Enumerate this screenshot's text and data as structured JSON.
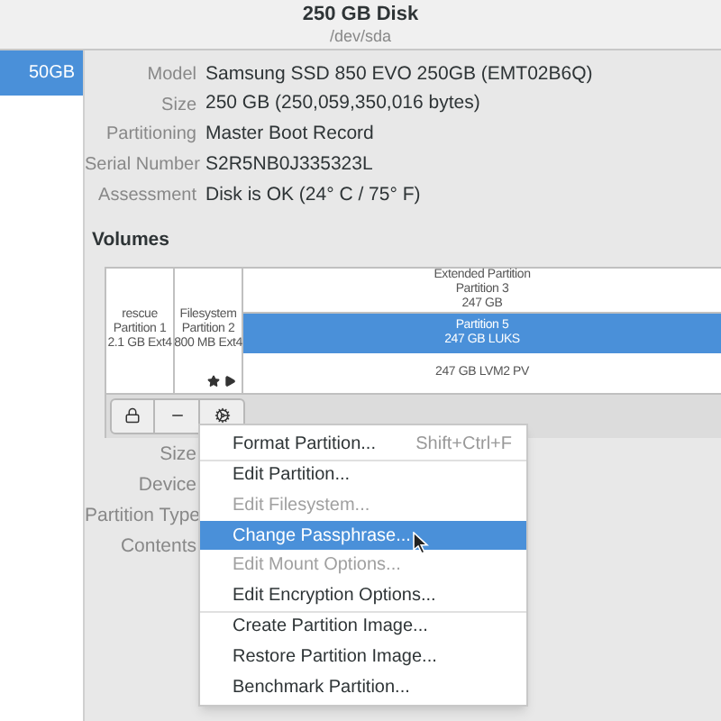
{
  "header": {
    "title": "250 GB Disk",
    "subtitle": "/dev/sda"
  },
  "sidebar": {
    "items": [
      {
        "label": "50GB",
        "selected": true
      }
    ]
  },
  "properties": [
    {
      "label": "Model",
      "value": "Samsung SSD 850 EVO 250GB (EMT02B6Q)"
    },
    {
      "label": "Size",
      "value": "250 GB (250,059,350,016 bytes)"
    },
    {
      "label": "Partitioning",
      "value": "Master Boot Record"
    },
    {
      "label": "Serial Number",
      "value": "S2R5NB0J335323L"
    },
    {
      "label": "Assessment",
      "value": "Disk is OK (24° C / 75° F)"
    }
  ],
  "volumes": {
    "heading": "Volumes",
    "partitions": [
      {
        "lines": [
          "rescue",
          "Partition 1",
          "2.1 GB Ext4"
        ],
        "selected": false,
        "mounted": false
      },
      {
        "lines": [
          "Filesystem",
          "Partition 2",
          "800 MB Ext4"
        ],
        "selected": false,
        "mounted": true
      }
    ],
    "extended": {
      "lines": [
        "Extended Partition",
        "Partition 3",
        "247 GB"
      ],
      "selected": false,
      "children": [
        {
          "lines": [
            "Partition 5",
            "247 GB LUKS"
          ],
          "selected": true
        },
        {
          "lines": [
            "247 GB LVM2 PV"
          ],
          "selected": false
        }
      ]
    }
  },
  "partition_properties": [
    {
      "label": "Size"
    },
    {
      "label": "Device"
    },
    {
      "label": "Partition Type"
    },
    {
      "label": "Contents"
    }
  ],
  "menu": {
    "groups": [
      [
        {
          "label": "Format Partition...",
          "shortcut": "Shift+Ctrl+F",
          "disabled": false,
          "selected": false
        }
      ],
      [
        {
          "label": "Edit Partition...",
          "disabled": false,
          "selected": false
        },
        {
          "label": "Edit Filesystem...",
          "disabled": true,
          "selected": false
        },
        {
          "label": "Change Passphrase...",
          "disabled": false,
          "selected": true
        },
        {
          "label": "Edit Mount Options...",
          "disabled": true,
          "selected": false
        },
        {
          "label": "Edit Encryption Options...",
          "disabled": false,
          "selected": false
        }
      ],
      [
        {
          "label": "Create Partition Image...",
          "disabled": false,
          "selected": false
        },
        {
          "label": "Restore Partition Image...",
          "disabled": false,
          "selected": false
        },
        {
          "label": "Benchmark Partition...",
          "disabled": false,
          "selected": false
        }
      ]
    ]
  }
}
